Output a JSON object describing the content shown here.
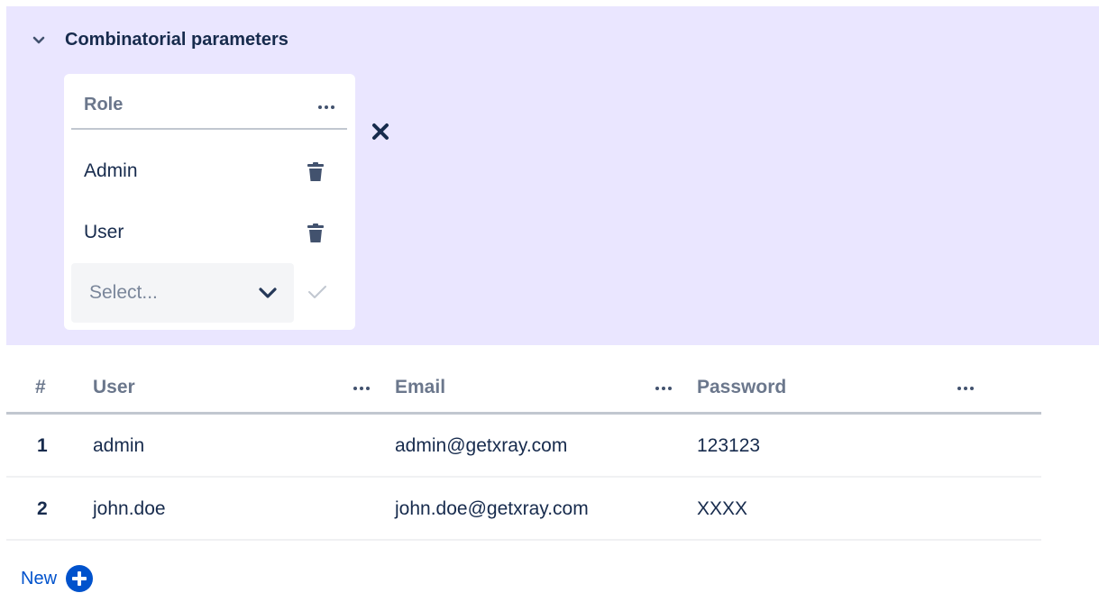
{
  "combinatorial": {
    "title": "Combinatorial parameters",
    "toggle_icon": "chevron-down-icon",
    "parameter": {
      "name": "Role",
      "values": [
        {
          "label": "Admin"
        },
        {
          "label": "User"
        }
      ],
      "select_placeholder": "Select..."
    }
  },
  "table": {
    "columns": [
      {
        "label": "#"
      },
      {
        "label": "User"
      },
      {
        "label": "Email"
      },
      {
        "label": "Password"
      }
    ],
    "rows": [
      {
        "num": "1",
        "user": "admin",
        "email": "admin@getxray.com",
        "password": "123123"
      },
      {
        "num": "2",
        "user": "john.doe",
        "email": "john.doe@getxray.com",
        "password": "XXXX"
      }
    ]
  },
  "new_button": {
    "label": "New"
  },
  "colors": {
    "panel_bg": "#eae6ff",
    "accent": "#0052cc",
    "text_primary": "#172b4d",
    "text_muted": "#6b778c"
  }
}
